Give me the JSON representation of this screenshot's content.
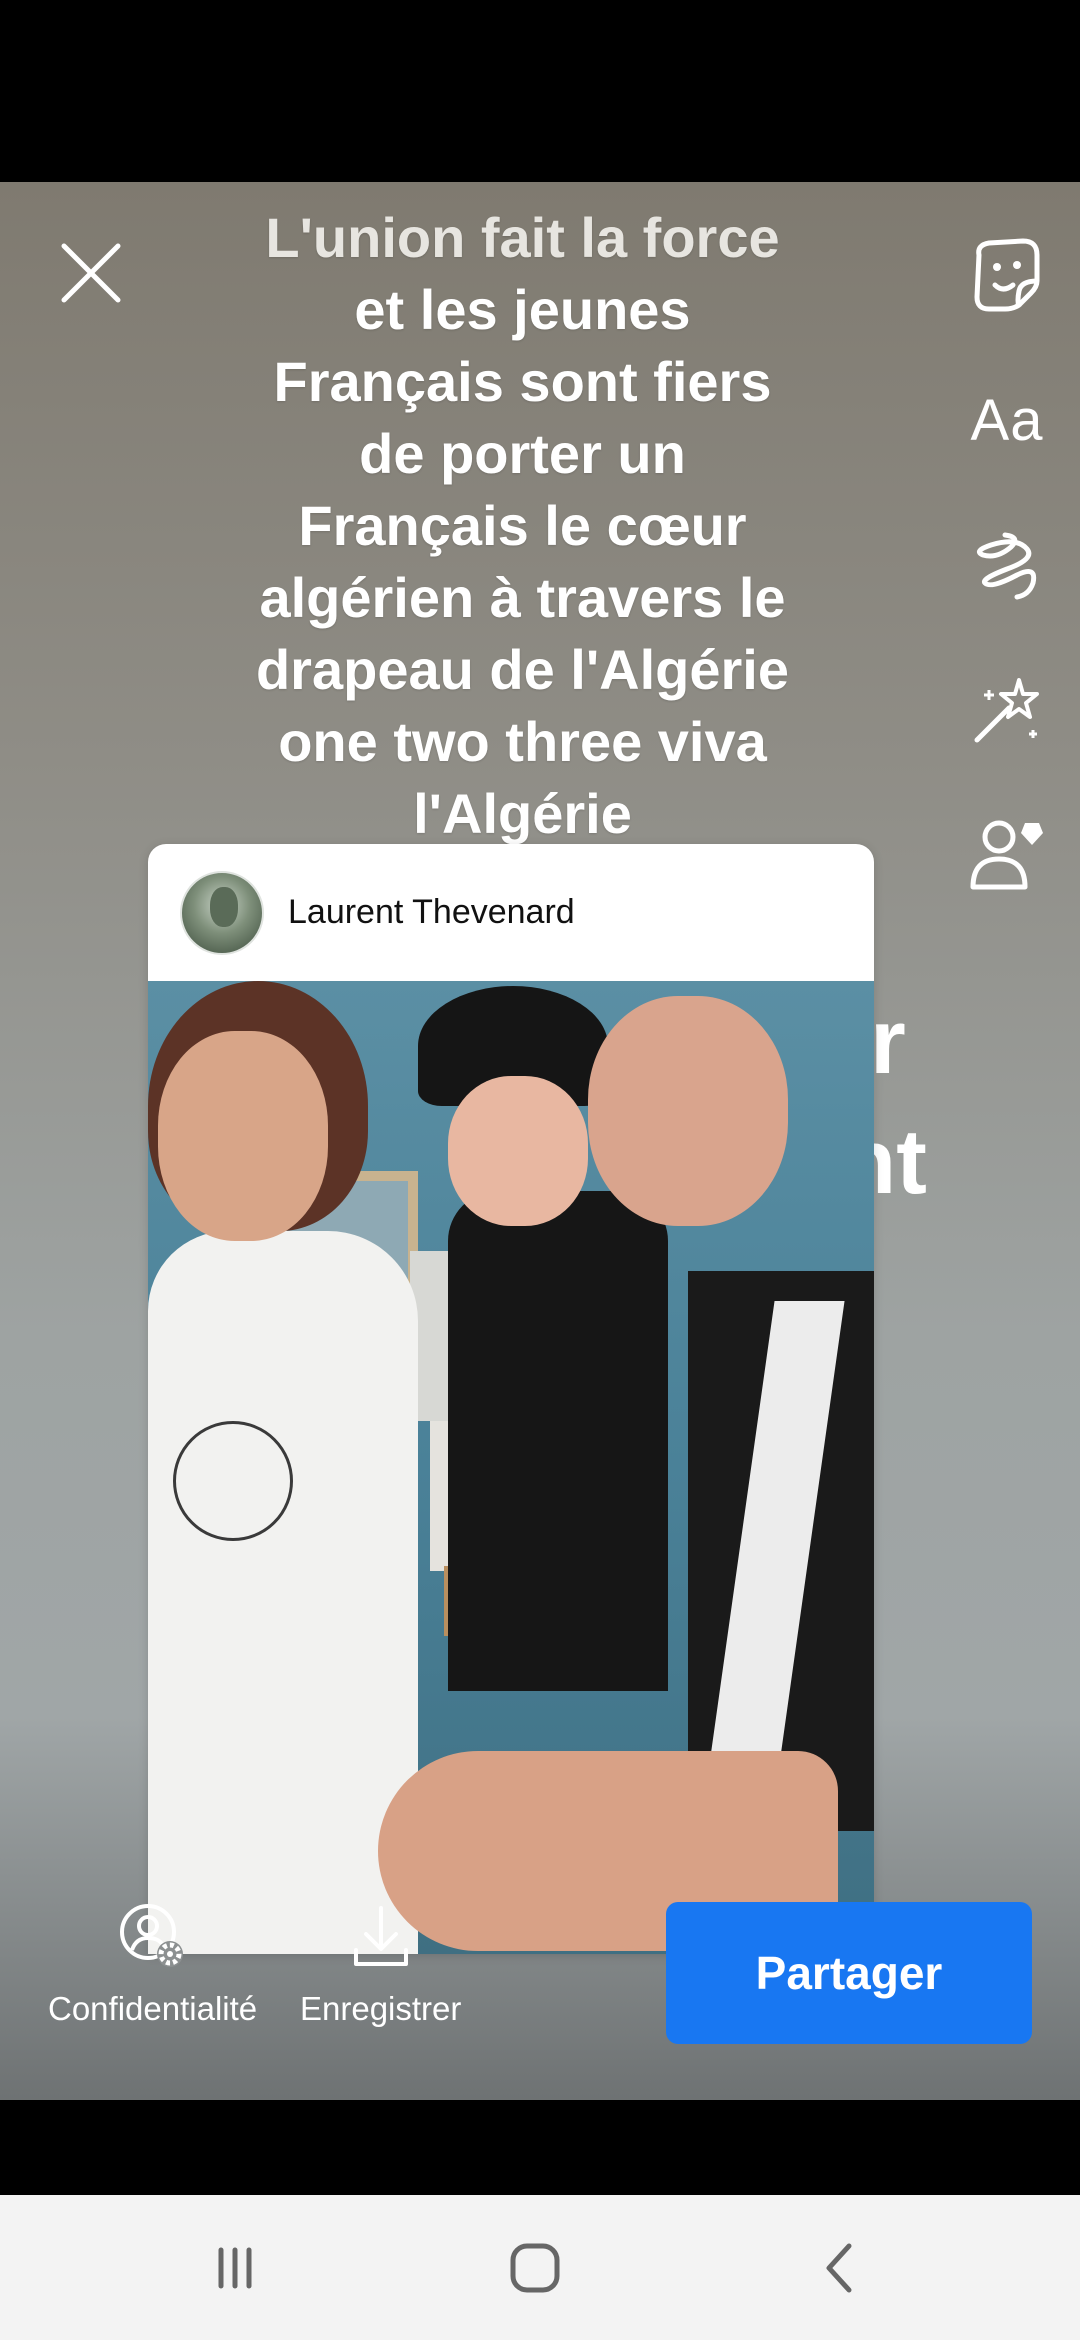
{
  "story": {
    "text_lines": [
      "L'union fait la force",
      "et les jeunes",
      "Français sont fiers",
      "de porter un",
      "Français le cœur",
      "algérien à travers le",
      "drapeau de l'Algérie",
      "one two three viva",
      "l'Algérie"
    ],
    "background_text_fragment_1": "r",
    "background_text_fragment_2": "nt"
  },
  "post": {
    "author": "Laurent Thevenard"
  },
  "toolbar_icons": [
    "sticker-icon",
    "text-icon",
    "draw-icon",
    "effects-icon",
    "tag-people-icon"
  ],
  "text_tool_label": "Aa",
  "actions": {
    "privacy_label": "Confidentialité",
    "save_label": "Enregistrer",
    "share_label": "Partager"
  },
  "colors": {
    "share_button": "#1877f2",
    "nav_bar": "#f3f3f3"
  }
}
